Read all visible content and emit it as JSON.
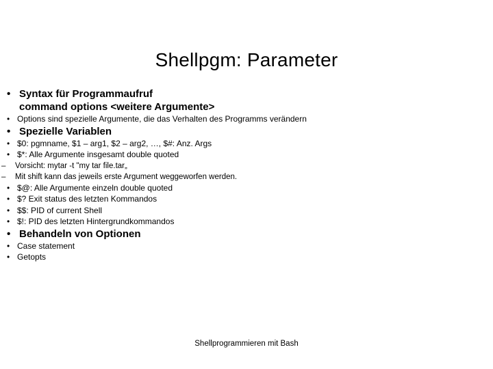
{
  "slide": {
    "title": "Shellpgm: Parameter",
    "footer": "Shellprogrammieren mit Bash",
    "bullet_glyph": "•",
    "dash_glyph": "–",
    "colors": {
      "background": "#ffffff",
      "text": "#000000"
    },
    "sections": [
      {
        "heading_line1": "Syntax für Programmaufruf",
        "heading_line2": "command options <weitere Argumente>",
        "sub_items": [
          "Options sind spezielle Argumente, die das Verhalten des Programms verändern"
        ]
      },
      {
        "heading_line1": "Spezielle Variablen",
        "sub_items": [
          "$0: pgmname,  $1 – arg1, $2 – arg2, …, $#: Anz. Args",
          "$*: Alle Argumente insgesamt double quoted",
          "$@: Alle Argumente einzeln double quoted",
          "$? Exit status des letzten Kommandos",
          "$$: PID of current Shell",
          "$!: PID des letzten Hintergrundkommandos"
        ],
        "dash_items": [
          "Vorsicht: mytar -t  \"my tar file.tar„",
          "Mit shift kann das jeweils erste Argument weggeworfen werden."
        ]
      },
      {
        "heading_line1": "Behandeln von Optionen",
        "sub_items": [
          "Case statement",
          "Getopts"
        ]
      }
    ]
  }
}
